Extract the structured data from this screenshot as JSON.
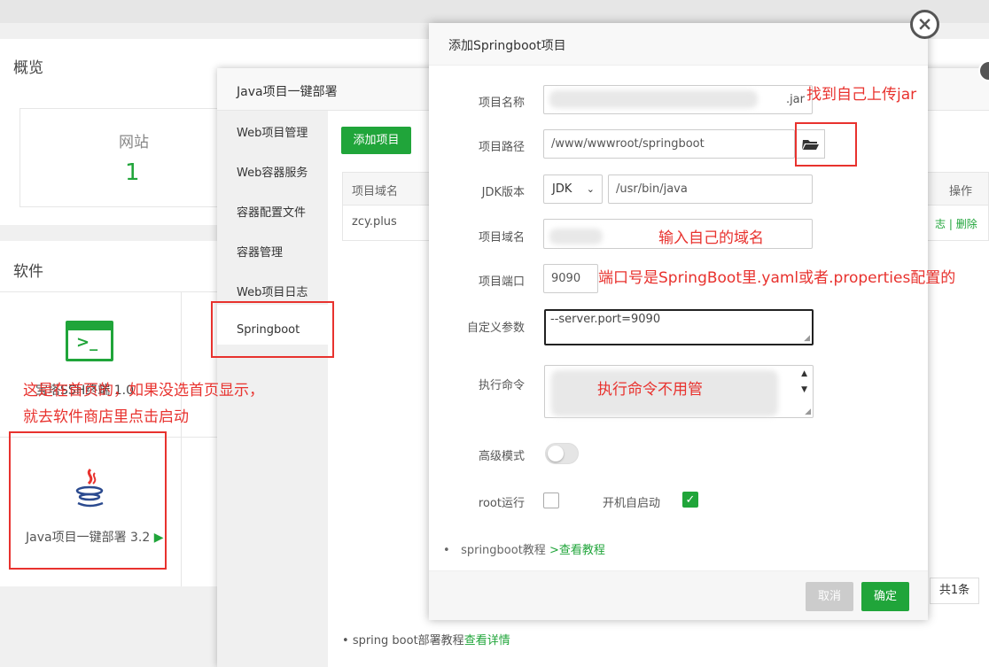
{
  "dashboard": {
    "overview_title": "概览",
    "site_label": "网站",
    "site_count": "1",
    "software_title": "软件",
    "ssh_label": "宝塔SSH终端 1.0",
    "java_label": "Java项目一键部署 3.2"
  },
  "java_window": {
    "title": "Java项目一键部署",
    "sidebar": [
      {
        "label": "Web项目管理"
      },
      {
        "label": "Web容器服务"
      },
      {
        "label": "容器配置文件"
      },
      {
        "label": "容器管理"
      },
      {
        "label": "Web项目日志"
      },
      {
        "label": "Springboot"
      }
    ],
    "add_button": "添加项目",
    "table": {
      "col_domain": "项目域名",
      "col_action": "操作",
      "rows": [
        {
          "domain": "zcy.plus",
          "action_log": "志",
          "action_delete": "删除"
        }
      ]
    },
    "pager_total": "共1条",
    "bottom_note_prefix": "spring boot部署教程",
    "bottom_note_link": "查看详情"
  },
  "dialog": {
    "title": "添加Springboot项目",
    "name_label": "项目名称",
    "name_value_suffix": ".jar",
    "path_label": "项目路径",
    "path_value": "/www/wwwroot/springboot",
    "jdk_label": "JDK版本",
    "jdk_select": "JDK",
    "jdk_path": "/usr/bin/java",
    "domain_label": "项目域名",
    "port_label": "项目端口",
    "port_value": "9090",
    "params_label": "自定义参数",
    "params_value": "--server.port=9090",
    "cmd_label": "执行命令",
    "advanced_label": "高级模式",
    "root_label": "root运行",
    "autostart_label": "开机自启动",
    "note_prefix": "springboot教程",
    "note_link": ">查看教程",
    "cancel": "取消",
    "confirm": "确定"
  },
  "annotations": {
    "find_jar": "找到自己上传jar",
    "input_domain": "输入自己的域名",
    "port_hint": "端口号是SpringBoot里.yaml或者.properties配置的",
    "cmd_hint": "执行命令不用管",
    "home_hint_line1": "这是在首页的，如果没选首页显示，",
    "home_hint_line2": "就去软件商店里点击启动"
  },
  "colors": {
    "accent": "#20a53a",
    "annotation": "#e8322e"
  }
}
